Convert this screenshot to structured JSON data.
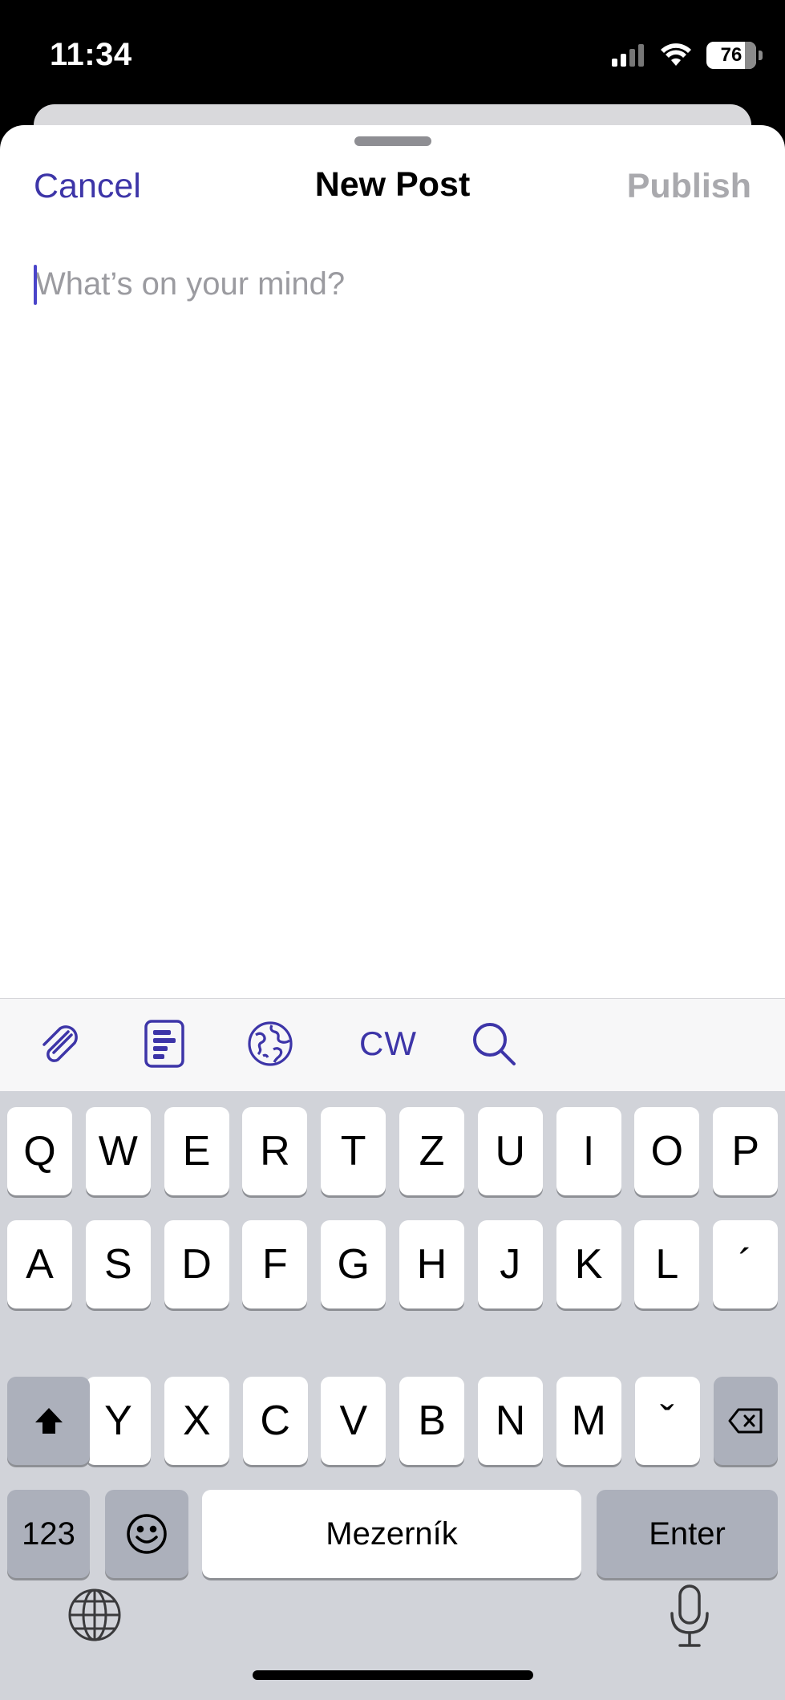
{
  "status_bar": {
    "time": "11:34",
    "battery": "76",
    "icons": [
      "cellular-signal-icon",
      "wifi-icon",
      "battery-icon"
    ]
  },
  "sheet": {
    "cancel_label": "Cancel",
    "title": "New Post",
    "publish_label": "Publish",
    "placeholder": "What’s on your mind?"
  },
  "toolbar": {
    "icons": [
      "paperclip-icon",
      "document-format-icon",
      "globe-visibility-icon",
      "search-icon"
    ],
    "cw_label": "CW",
    "accent_color": "#3d35a8"
  },
  "keyboard": {
    "row1": [
      "Q",
      "W",
      "E",
      "R",
      "T",
      "Z",
      "U",
      "I",
      "O",
      "P"
    ],
    "row2": [
      "A",
      "S",
      "D",
      "F",
      "G",
      "H",
      "J",
      "K",
      "L",
      "´"
    ],
    "row3": [
      "Y",
      "X",
      "C",
      "V",
      "B",
      "N",
      "M",
      "ˇ"
    ],
    "numbers_label": "123",
    "space_label": "Mezerník",
    "enter_label": "Enter"
  },
  "colors": {
    "accent": "#3d35a8",
    "disabled": "#a9a9ad",
    "keyboard_bg": "#d1d3d9"
  }
}
